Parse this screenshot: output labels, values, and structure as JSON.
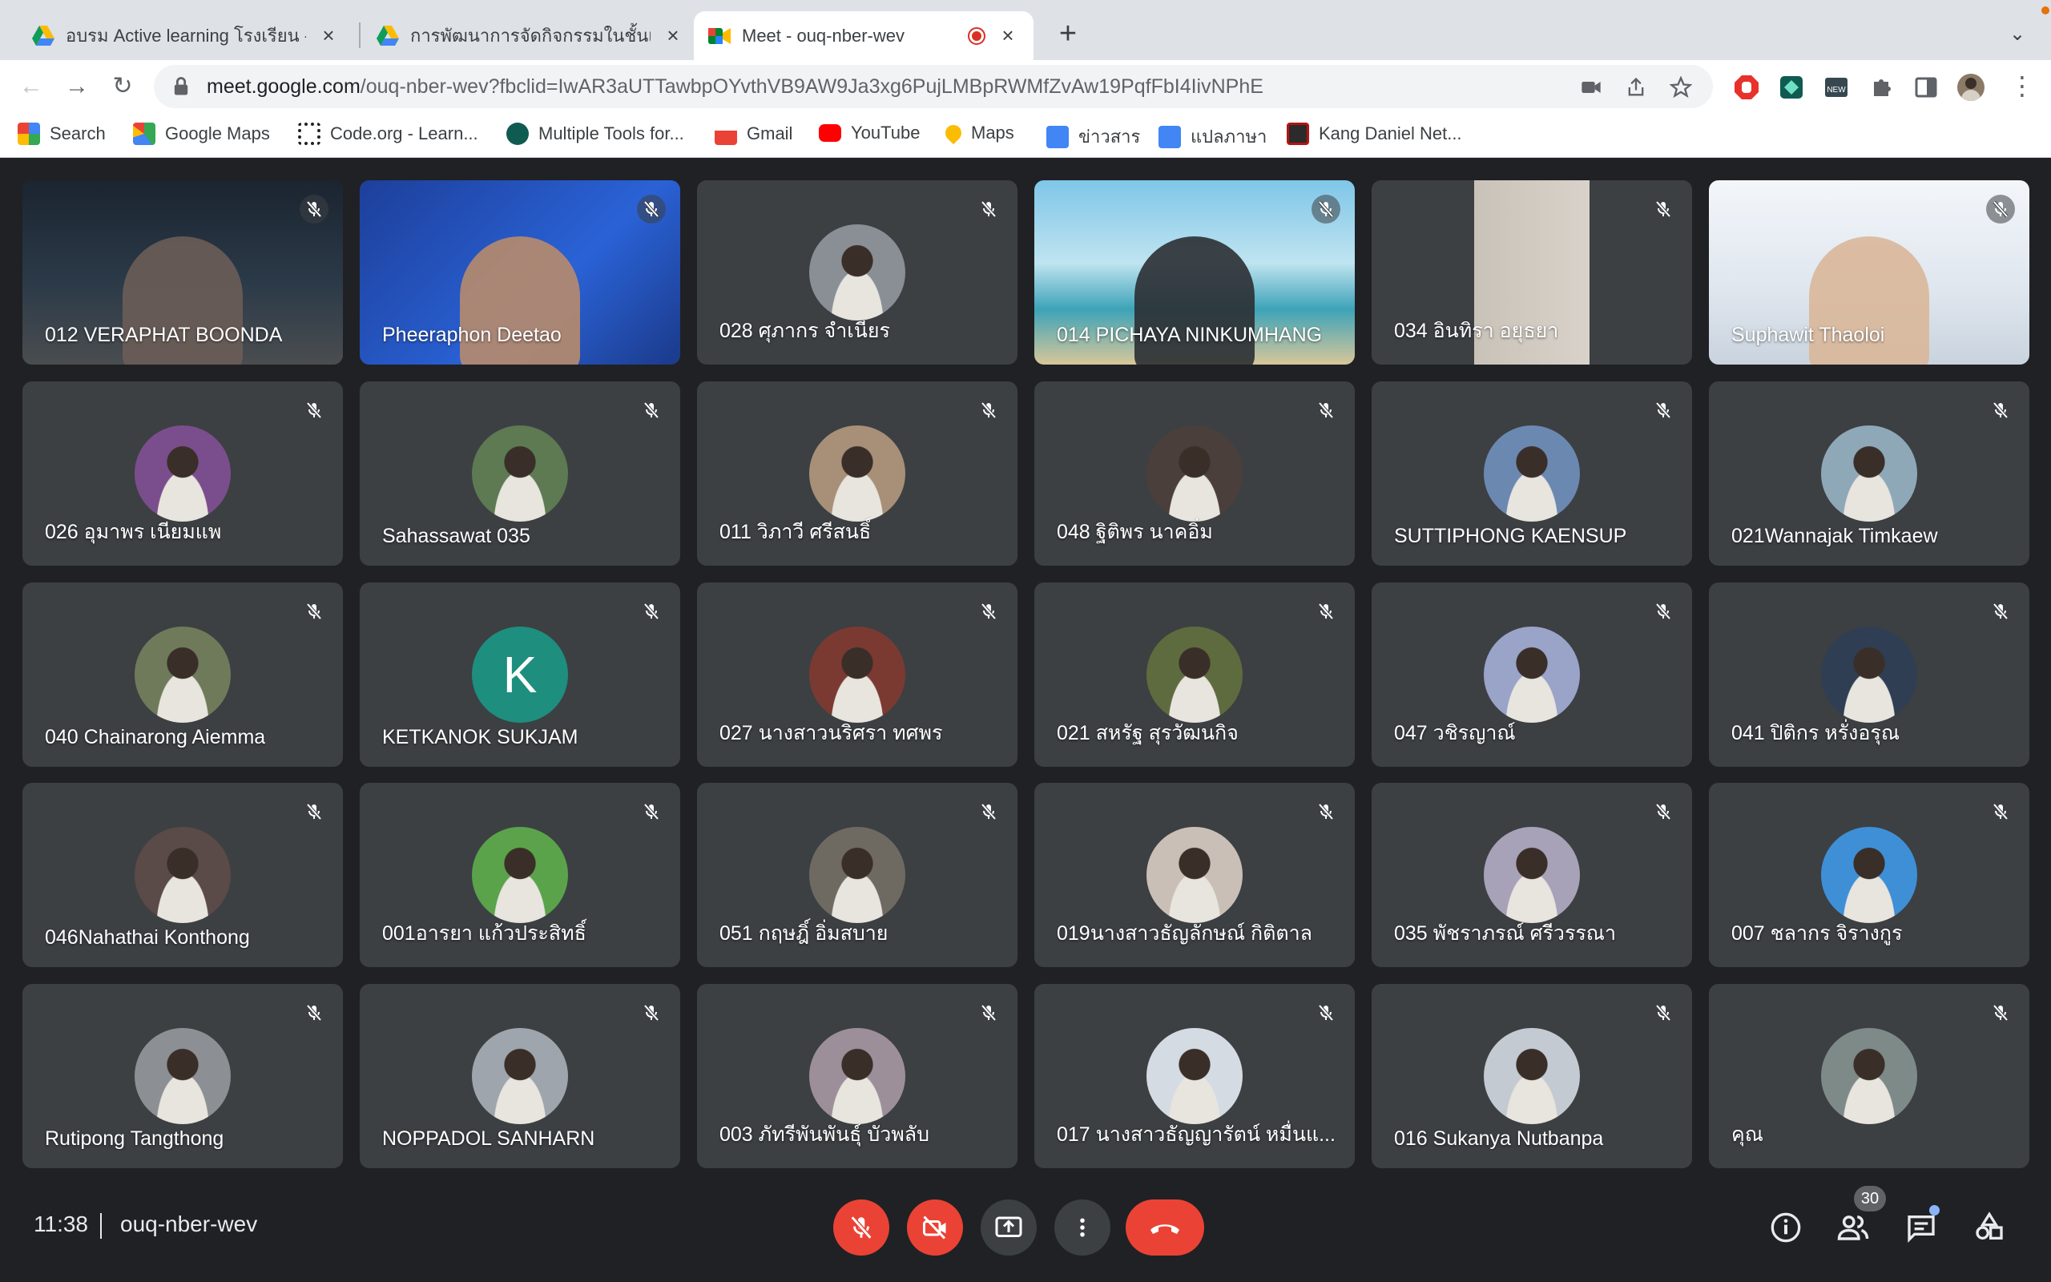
{
  "browser": {
    "tabs": [
      {
        "title": "อบรม Active learning โรงเรียน -",
        "favicon": "drive-icon",
        "active": false
      },
      {
        "title": "การพัฒนาการจัดกิจกรรมในชั้นเรียน",
        "favicon": "drive-icon",
        "active": false
      },
      {
        "title": "Meet - ouq-nber-wev",
        "favicon": "meet-icon",
        "active": true,
        "recording": true
      }
    ],
    "url_host": "meet.google.com",
    "url_path": "/ouq-nber-wev?fbclid=IwAR3aUTTawbpOYvthVB9AW9Ja3xg6PujLMBpRWMfZvAw19PqfFbI4IivNPhE",
    "bookmarks": [
      {
        "label": "Search",
        "icon": "google-search-icon",
        "color": "#4285f4"
      },
      {
        "label": "Google Maps",
        "icon": "google-maps-icon",
        "color": "#34a853"
      },
      {
        "label": "Code.org - Learn...",
        "icon": "code-org-icon",
        "color": "#202124"
      },
      {
        "label": "Multiple Tools for...",
        "icon": "tools-icon",
        "color": "#0f9d58"
      },
      {
        "label": "Gmail",
        "icon": "gmail-icon",
        "color": "#ea4335"
      },
      {
        "label": "YouTube",
        "icon": "youtube-icon",
        "color": "#ff0000"
      },
      {
        "label": "Maps",
        "icon": "maps-pin-icon",
        "color": "#fbbc04"
      },
      {
        "label": "ข่าวสาร",
        "icon": "news-icon",
        "color": "#4285f4"
      },
      {
        "label": "แปลภาษา",
        "icon": "translate-icon",
        "color": "#4285f4"
      },
      {
        "label": "Kang Daniel Net...",
        "icon": "star-site-icon",
        "color": "#b31412"
      }
    ]
  },
  "meet": {
    "participants": [
      {
        "name": "012 VERAPHAT BOONDA",
        "video": "night-city",
        "muted": true
      },
      {
        "name": "Pheeraphon Deetao",
        "video": "blue-slide",
        "muted": true
      },
      {
        "name": "028 ศุภากร จำเนียร",
        "avatar": "#8a8f96",
        "muted": true
      },
      {
        "name": "014 PICHAYA NINKUMHANG",
        "video": "beach",
        "muted": true
      },
      {
        "name": "034 อินทิรา อยุธยา",
        "video": "room",
        "muted": true
      },
      {
        "name": "Suphawit Thaoloi",
        "video": "poster",
        "muted": true
      },
      {
        "name": "026 อุมาพร เนียมแพ",
        "avatar": "#7a4e8c",
        "muted": true
      },
      {
        "name": "Sahassawat 035",
        "avatar": "#5d7a52",
        "muted": true
      },
      {
        "name": "011 วิภาวี ศรีสนธิ์",
        "avatar": "#a88f78",
        "muted": true
      },
      {
        "name": "048 ฐิติพร นาคอิ่ม",
        "avatar": "#4a3f3a",
        "muted": true
      },
      {
        "name": "SUTTIPHONG KAENSUP",
        "avatar": "#6b88b0",
        "muted": true
      },
      {
        "name": "021Wannajak Timkaew",
        "avatar": "#8fa8b8",
        "muted": true
      },
      {
        "name": "040 Chainarong Aiemma",
        "avatar": "#6f7a5a",
        "muted": true
      },
      {
        "name": "KETKANOK SUKJAM",
        "initial": "K",
        "avatar": "#1e8e7e",
        "muted": true
      },
      {
        "name": "027 นางสาวนริศรา ทศพร",
        "avatar": "#7a3a32",
        "muted": true
      },
      {
        "name": "021 สหรัฐ สุรวัฒนกิจ",
        "avatar": "#5e6b3e",
        "muted": true
      },
      {
        "name": "047 วชิรญาณ์",
        "avatar": "#9aa3c8",
        "muted": true
      },
      {
        "name": "041 ปิติกร หรั่งอรุณ",
        "avatar": "#2f3e52",
        "muted": true
      },
      {
        "name": "046Nahathai Konthong",
        "avatar": "#5a4a48",
        "muted": true
      },
      {
        "name": "001อารยา แก้วประสิทธิ์",
        "avatar": "#5aa34a",
        "muted": true
      },
      {
        "name": "051 กฤษฎิ์ อิ่มสบาย",
        "avatar": "#6e6a62",
        "muted": true
      },
      {
        "name": "019นางสาวธัญลักษณ์ กิติตาล",
        "avatar": "#c9bfb6",
        "muted": true
      },
      {
        "name": "035 พัชราภรณ์ ศรีวรรณา",
        "avatar": "#a7a2b8",
        "muted": true
      },
      {
        "name": "007 ชลากร จิรางกูร",
        "avatar": "#3f8fd6",
        "muted": true
      },
      {
        "name": "Rutipong Tangthong",
        "avatar": "#8c8f93",
        "muted": true
      },
      {
        "name": "NOPPADOL SANHARN",
        "avatar": "#9ea5ad",
        "muted": true
      },
      {
        "name": "003 ภัทรีพันพันธุ์ บัวพลับ",
        "avatar": "#9c8f9a",
        "muted": true
      },
      {
        "name": "017 นางสาวธัญญารัตน์ หมื่นแ...",
        "avatar": "#d5dbe2",
        "muted": true
      },
      {
        "name": "016 Sukanya Nutbanpa",
        "avatar": "#c4cad1",
        "muted": true
      },
      {
        "name": "คุณ",
        "avatar": "#7e8a88",
        "muted": true
      }
    ],
    "clock": "11:38",
    "meeting_code": "ouq-nber-wev",
    "people_count": "30",
    "colors": {
      "end_call": "#ea4335",
      "muted_control": "#ea4335",
      "control": "#3c4043",
      "tile": "#3c4043",
      "background": "#202124"
    }
  }
}
